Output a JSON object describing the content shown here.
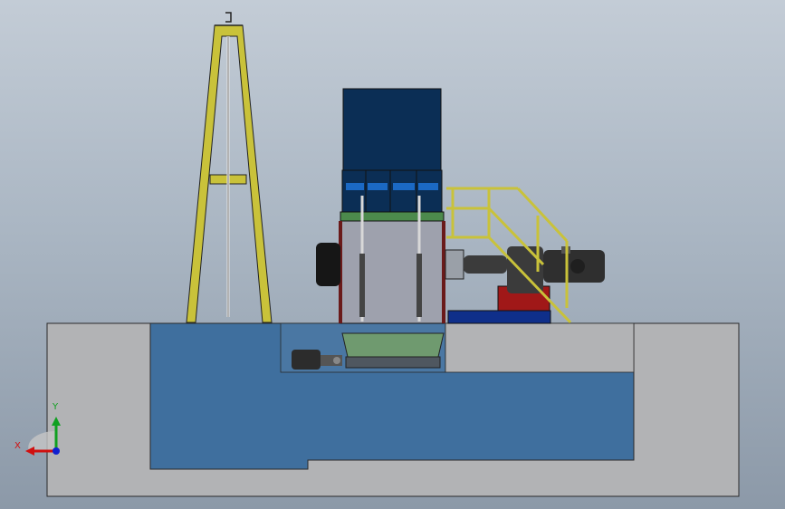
{
  "window": {
    "title": "",
    "background_top": "#c3ccd6",
    "background_bottom": "#8c99a8"
  },
  "model": {
    "frame_color": "#c9c23a",
    "hopper_color": "#0b2e55",
    "hopper_window_color": "#1b69c4",
    "chamber_color": "#9ea1ad",
    "pit_color": "#3f6f9e",
    "foundation_color": "#b2b3b5",
    "hydraulic_unit_color": "#a01818",
    "base_color": "#0f2f8a",
    "motor_color": "#3b3b3b"
  },
  "triad": {
    "x_label": "X",
    "y_label": "Y",
    "x_color": "#d01010",
    "y_color": "#10a020",
    "z_color": "#1020d0"
  }
}
